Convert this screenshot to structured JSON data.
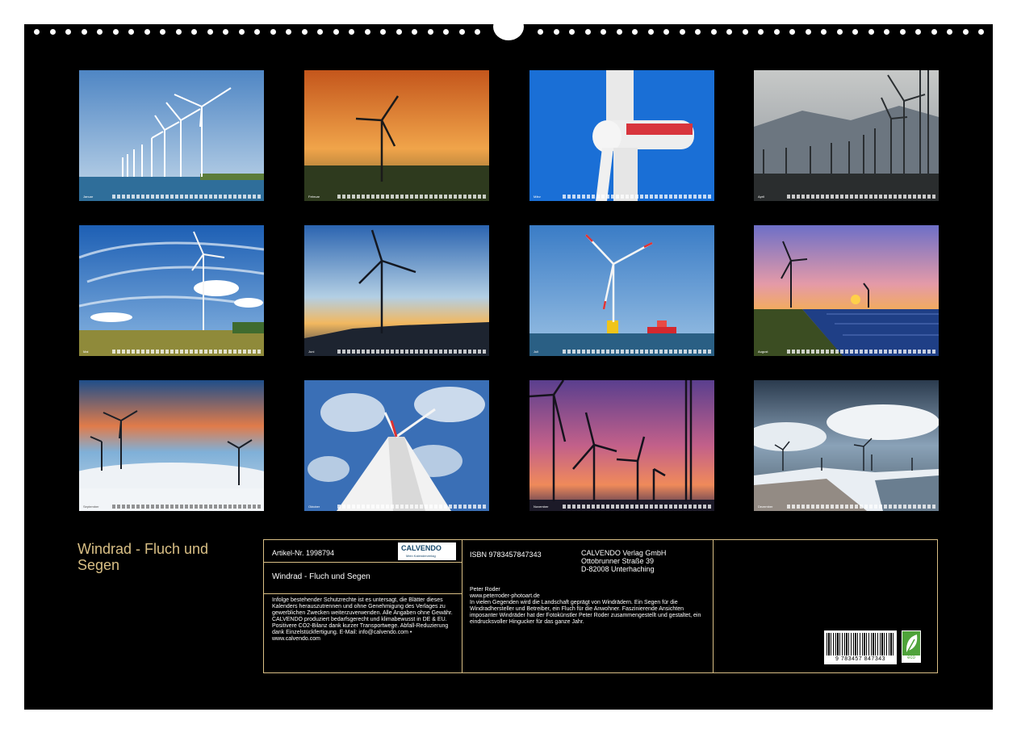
{
  "photos": [
    {
      "month": "Januar",
      "scene": "row-of-turbines-coast"
    },
    {
      "month": "Februar",
      "scene": "single-turbine-orange-sunset"
    },
    {
      "month": "März",
      "scene": "nacelle-closeup-blue-sky"
    },
    {
      "month": "April",
      "scene": "turbines-misty-mountains"
    },
    {
      "month": "Mai",
      "scene": "turbine-wispy-clouds-field"
    },
    {
      "month": "Juni",
      "scene": "turbine-silhouette-dusk"
    },
    {
      "month": "Juli",
      "scene": "offshore-turbine-red-ship"
    },
    {
      "month": "August",
      "scene": "turbine-solar-park-sunset"
    },
    {
      "month": "September",
      "scene": "turbines-above-fog"
    },
    {
      "month": "Oktober",
      "scene": "looking-up-tower-clouds"
    },
    {
      "month": "November",
      "scene": "turbine-silhouettes-pink-sky"
    },
    {
      "month": "Dezember",
      "scene": "turbines-snowy-landscape"
    }
  ],
  "calendar": {
    "title": "Windrad - Fluch und Segen",
    "article_label": "Artikel-Nr. 1998794",
    "logo_name": "CALVENDO",
    "logo_tagline": "Mein Kalenderverlag",
    "box_title": "Windrad - Fluch und Segen",
    "legal_text": "Infolge bestehender Schutzrechte ist es untersagt, die Blätter dieses Kalenders herauszutrennen und ohne Genehmigung des Verlages zu gewerblichen Zwecken weiterzuverwenden. Alle Angaben ohne Gewähr. CALVENDO produziert bedarfsgerecht und klimabewusst in DE & EU. Positivere CO2-Bilanz dank kurzer Transportwege. Abfall-Reduzierung dank Einzelstückfertigung. E-Mail: info@calvendo.com • www.calvendo.com",
    "isbn": "ISBN 9783457847343",
    "publisher": {
      "name": "CALVENDO Verlag GmbH",
      "street": "Ottobrunner Straße 39",
      "city": "D-82008 Unterhaching"
    },
    "author": "Peter Roder",
    "website": "www.peterroder-photoart.de",
    "description": "In vielen Gegenden wird die Landschaft geprägt von Windrädern. Ein Segen für die Windradhersteller und Betreiber, ein Fluch für die Anwohner. Faszinierende Ansichten imposanter Windräder hat der Fotokünstler Peter Roder zusammengestellt und gestaltet, ein eindrucksvoller Hingucker für das ganze Jahr.",
    "barcode_number": "9 783457 847343",
    "eco_label": "eco"
  },
  "colors": {
    "accent": "#d9bf85",
    "background": "#000000"
  }
}
